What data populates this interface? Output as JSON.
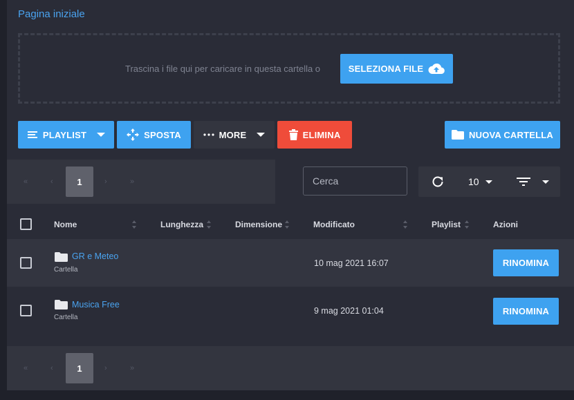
{
  "breadcrumb": {
    "label": "Pagina iniziale"
  },
  "dropzone": {
    "text": "Trascina i file qui per caricare in questa cartella o",
    "select_label": "SELEZIONA FILE"
  },
  "toolbar": {
    "playlist_label": "PLAYLIST",
    "move_label": "SPOSTA",
    "more_label": "MORE",
    "delete_label": "ELIMINA",
    "new_folder_label": "NUOVA CARTELLA"
  },
  "pagination": {
    "first": "«",
    "prev": "‹",
    "current": "1",
    "next": "›",
    "last": "»"
  },
  "search": {
    "placeholder": "Cerca",
    "value": ""
  },
  "per_page": {
    "value": "10"
  },
  "table": {
    "headers": [
      "Nome",
      "Lunghezza",
      "Dimensione",
      "Modificato",
      "Playlist",
      "Azioni"
    ],
    "rows": [
      {
        "name": "GR e Meteo",
        "type": "Cartella",
        "modified": "10 mag 2021 16:07",
        "action": "RINOMINA"
      },
      {
        "name": "Musica Free",
        "type": "Cartella",
        "modified": "9 mag 2021 01:04",
        "action": "RINOMINA"
      }
    ]
  },
  "colors": {
    "accent": "#3ea2f0",
    "danger": "#ef4c3a",
    "background": "#2a2c37"
  },
  "icons": [
    "list-icon",
    "move-arrows-icon",
    "more-dots-icon",
    "trash-icon",
    "folder-icon",
    "cloud-upload-icon",
    "refresh-icon",
    "filter-icon",
    "checkbox-icon"
  ]
}
